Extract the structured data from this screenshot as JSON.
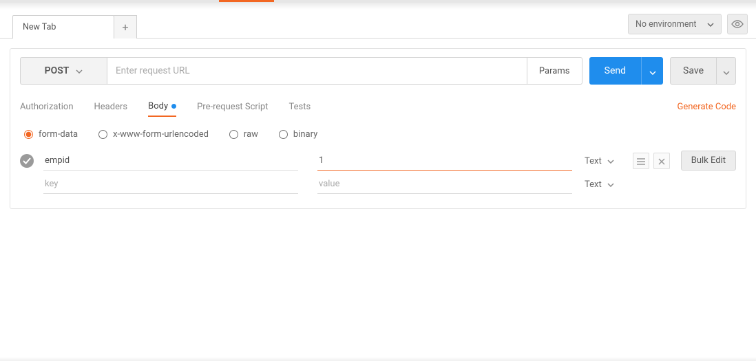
{
  "tabs": {
    "items": [
      {
        "label": "New Tab"
      }
    ]
  },
  "env": {
    "label": "No environment"
  },
  "method": "POST",
  "url": {
    "value": "",
    "placeholder": "Enter request URL"
  },
  "buttons": {
    "params": "Params",
    "send": "Send",
    "save": "Save",
    "generate_code": "Generate Code",
    "bulk_edit": "Bulk Edit"
  },
  "request_tabs": {
    "authorization": "Authorization",
    "headers": "Headers",
    "body": "Body",
    "prerequest": "Pre-request Script",
    "tests": "Tests",
    "active": "body"
  },
  "body_types": {
    "formdata": "form-data",
    "urlencoded": "x-www-form-urlencoded",
    "raw": "raw",
    "binary": "binary",
    "selected": "formdata"
  },
  "formdata": {
    "rows": [
      {
        "key": "empid",
        "value": "1",
        "type": "Text",
        "enabled": true
      },
      {
        "key": "",
        "value": "",
        "type": "Text",
        "enabled": false
      }
    ],
    "key_placeholder": "key",
    "value_placeholder": "value"
  }
}
